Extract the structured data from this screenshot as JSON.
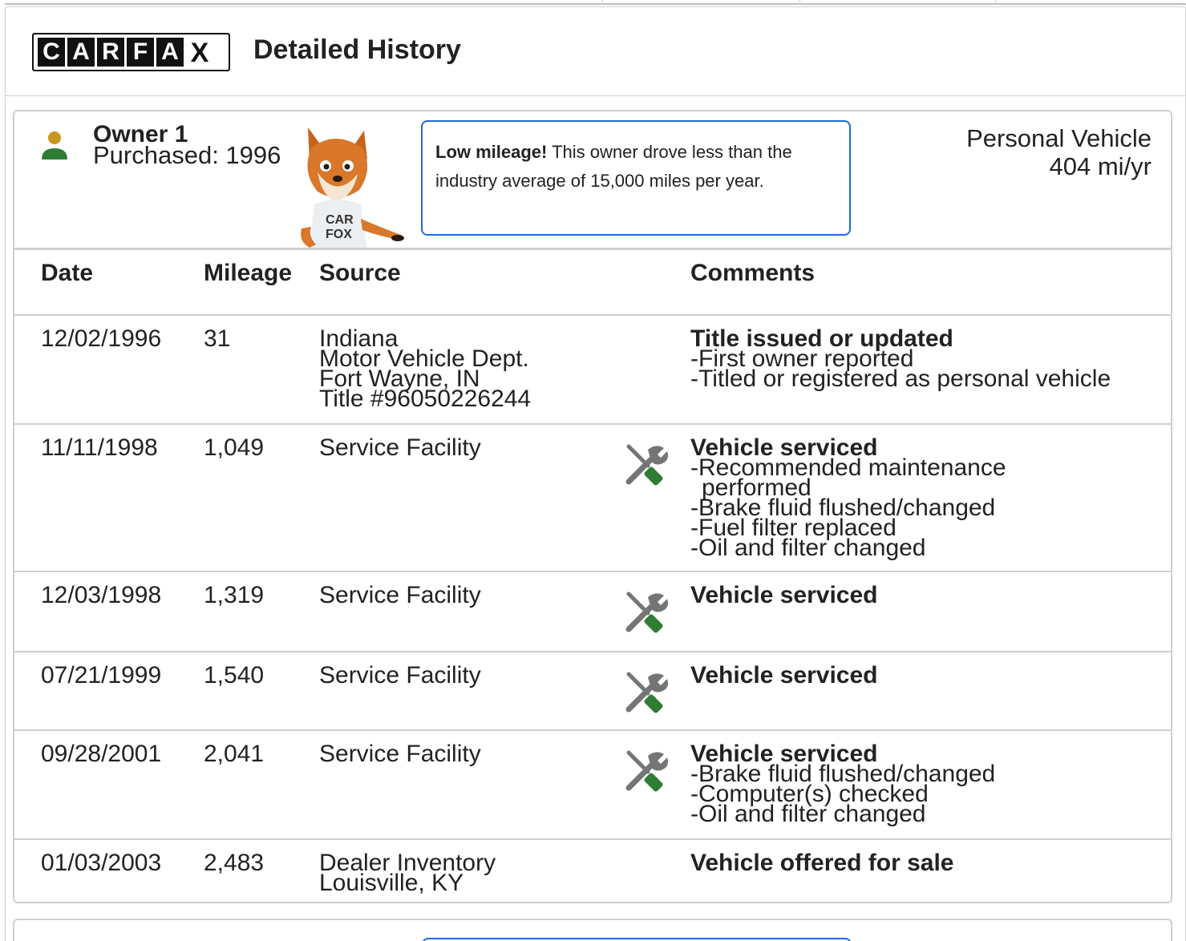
{
  "header": {
    "title": "Detailed History",
    "logo": {
      "letters": [
        "C",
        "A",
        "R",
        "F",
        "A",
        "X"
      ]
    }
  },
  "owner": {
    "name": "Owner 1",
    "purchased": "Purchased: 1996",
    "callout_bold": "Low mileage!",
    "callout_text": " This owner drove less than the industry average of 15,000 miles per year.",
    "usage_type": "Personal Vehicle",
    "usage_rate": "404 mi/yr",
    "mascot_shirt": "CAR FOX"
  },
  "table": {
    "headers": {
      "date": "Date",
      "mileage": "Mileage",
      "source": "Source",
      "comments": "Comments"
    },
    "rows": [
      {
        "date": "12/02/1996",
        "mileage": "31",
        "source": [
          "Indiana",
          "Motor Vehicle Dept.",
          "Fort Wayne, IN",
          "Title #96050226244"
        ],
        "icon": "",
        "comment_title": "Title issued or updated",
        "comment_items": [
          "-First owner reported",
          "-Titled or registered as personal vehicle"
        ]
      },
      {
        "date": "11/11/1998",
        "mileage": "1,049",
        "source": [
          "Service Facility"
        ],
        "icon": "wrench-screwdriver-icon",
        "comment_title": "Vehicle serviced",
        "comment_items": [
          "-Recommended maintenance",
          " performed",
          "-Brake fluid flushed/changed",
          "-Fuel filter replaced",
          "-Oil and filter changed"
        ]
      },
      {
        "date": "12/03/1998",
        "mileage": "1,319",
        "source": [
          "Service Facility"
        ],
        "icon": "wrench-screwdriver-icon",
        "comment_title": "Vehicle serviced",
        "comment_items": []
      },
      {
        "date": "07/21/1999",
        "mileage": "1,540",
        "source": [
          "Service Facility"
        ],
        "icon": "wrench-screwdriver-icon",
        "comment_title": "Vehicle serviced",
        "comment_items": []
      },
      {
        "date": "09/28/2001",
        "mileage": "2,041",
        "source": [
          "Service Facility"
        ],
        "icon": "wrench-screwdriver-icon",
        "comment_title": "Vehicle serviced",
        "comment_items": [
          "-Brake fluid flushed/changed",
          "-Computer(s) checked",
          "-Oil and filter changed"
        ]
      },
      {
        "date": "01/03/2003",
        "mileage": "2,483",
        "source": [
          "Dealer Inventory",
          "Louisville, KY"
        ],
        "icon": "",
        "comment_title": "Vehicle offered for sale",
        "comment_items": []
      }
    ]
  },
  "colors": {
    "accent_blue": "#1e6bd0",
    "icon_green": "#2e7d32",
    "icon_gray": "#757575",
    "owner_gold": "#c8961e"
  }
}
